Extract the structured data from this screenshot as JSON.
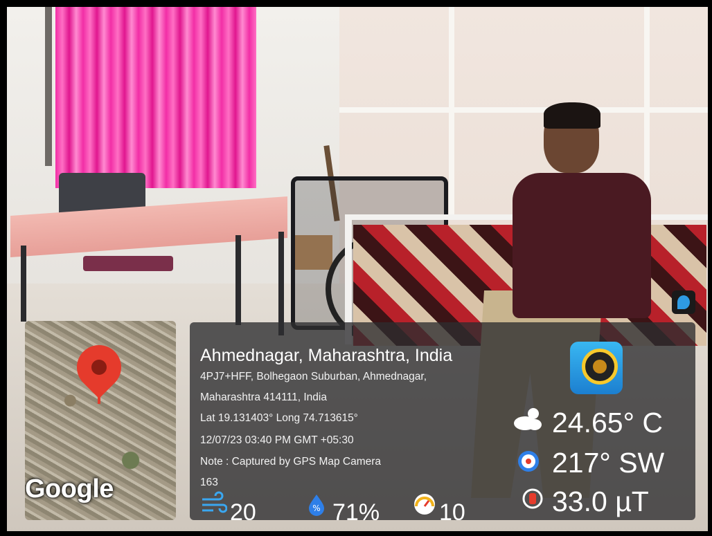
{
  "map": {
    "attribution": "Google"
  },
  "location": {
    "title": "Ahmednagar, Maharashtra, India",
    "address_line1": "4PJ7+HFF, Bolhegaon Suburban, Ahmednagar,",
    "address_line2": "Maharashtra 414111, India",
    "coordinates": "Lat 19.131403° Long 74.713615°",
    "datetime": "12/07/23 03:40 PM GMT +05:30",
    "note": "Note : Captured by GPS Map Camera",
    "extra": "163"
  },
  "weather": {
    "temperature": "24.65° C",
    "wind_direction": "217° SW",
    "magnetic_field": "33.0 µT",
    "wind_speed": "20",
    "humidity": "71%",
    "pressure": "10"
  },
  "icons": {
    "temperature": "cloud-sun-icon",
    "wind_direction": "compass-icon",
    "magnetic_field": "magnet-icon",
    "wind_speed": "wind-icon",
    "humidity": "humidity-icon",
    "pressure": "gauge-icon",
    "app": "gps-map-camera-app-icon"
  }
}
